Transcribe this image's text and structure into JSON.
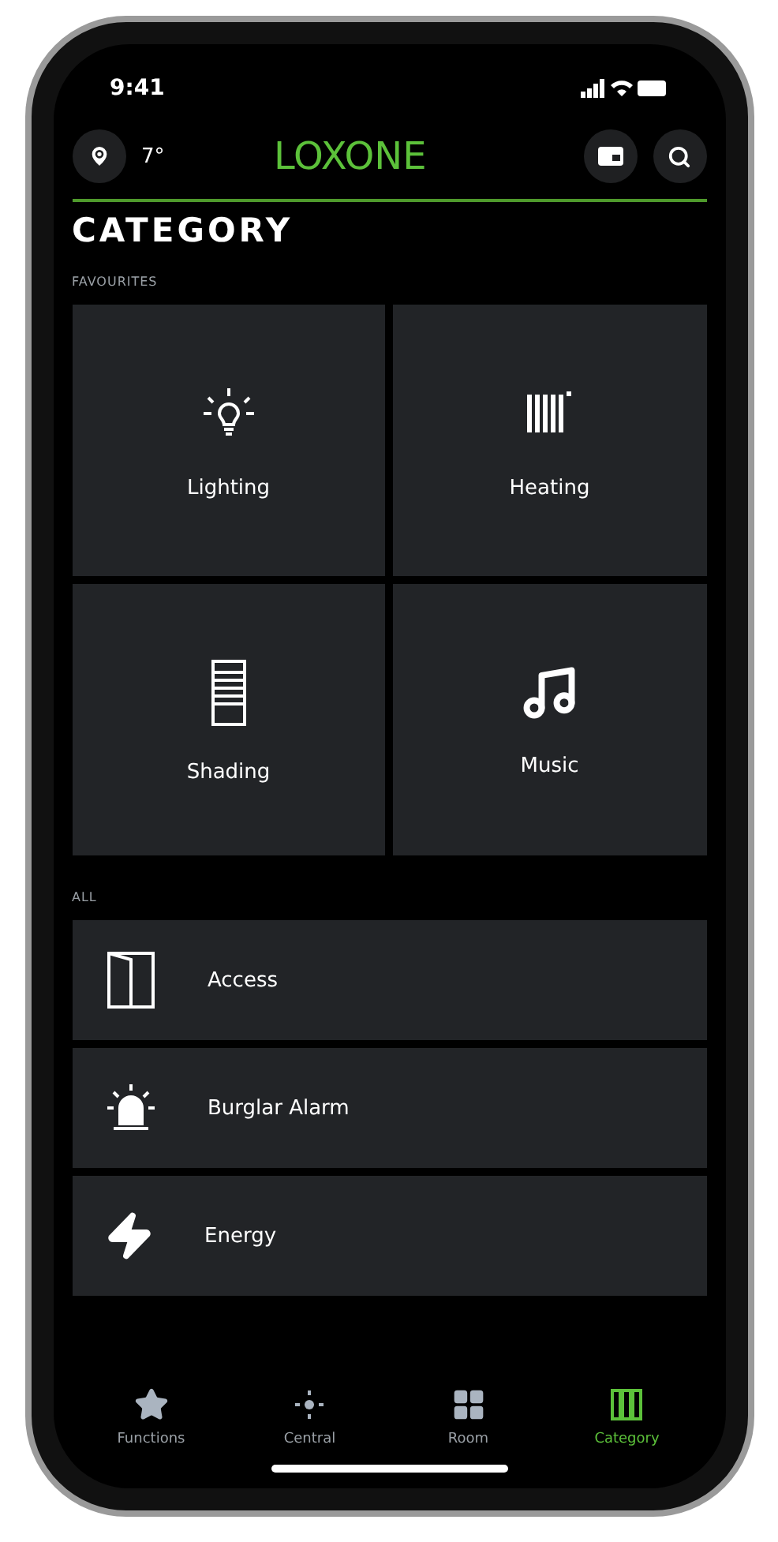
{
  "status_bar": {
    "time": "9:41"
  },
  "header": {
    "temperature": "7°",
    "logo": "LOXONE"
  },
  "title": "CATEGORY",
  "favourites": {
    "label": "FAVOURITES",
    "tiles": [
      {
        "kind": "lighting",
        "label": "Lighting"
      },
      {
        "kind": "heating",
        "label": "Heating"
      },
      {
        "kind": "shading",
        "label": "Shading"
      },
      {
        "kind": "music",
        "label": "Music"
      }
    ]
  },
  "all": {
    "label": "ALL",
    "rows": [
      {
        "kind": "access",
        "label": "Access"
      },
      {
        "kind": "alarm",
        "label": "Burglar Alarm"
      },
      {
        "kind": "energy",
        "label": "Energy"
      }
    ]
  },
  "tabs": [
    {
      "kind": "functions",
      "label": "Functions",
      "selected": false
    },
    {
      "kind": "central",
      "label": "Central",
      "selected": false
    },
    {
      "kind": "room",
      "label": "Room",
      "selected": false
    },
    {
      "kind": "category",
      "label": "Category",
      "selected": true
    }
  ]
}
